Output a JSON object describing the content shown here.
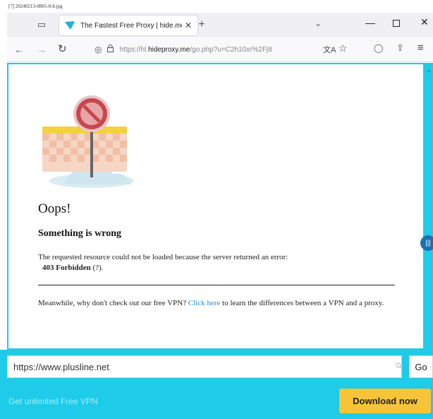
{
  "file_caption": "[7] 20240213-0805-0-8.jpg",
  "browser": {
    "tab": {
      "title": "The Fastest Free Proxy | hide.me",
      "close_glyph": "✕"
    },
    "new_tab_glyph": "+",
    "overflow_glyph": "⌄",
    "window_controls": {
      "minimize": "—",
      "close": "✕"
    },
    "nav": {
      "back": "←",
      "forward": "→",
      "reload": "↻"
    },
    "url": {
      "prefix": "https://hl.",
      "host": "hideproxy.me",
      "path": "/go.php?u=C2h10xr%2Fj8"
    },
    "icons": {
      "translate": "文A",
      "bookmark": "☆",
      "pocket": "◯",
      "extensions": "⇪",
      "menu": "≡",
      "shield": "◎",
      "lock": "🔒"
    }
  },
  "page": {
    "heading": "Oops!",
    "subheading": "Something is wrong",
    "error_message": "The requested resource could not be loaded because the server returned an error:",
    "error_code": "403 Forbidden",
    "error_help": "(?).",
    "vpn_text_before": "Meanwhile, why don't check out our free VPN?",
    "vpn_link": "Click here",
    "vpn_text_after": "to learn the differences between a VPN and a proxy.",
    "scroll_glyph": "^",
    "side_handle_glyph": "|||"
  },
  "proxy_bar": {
    "url_value": "https://www.plusline.net",
    "go_label": "Go",
    "promo_text": "Get unlimited Free VPN",
    "download_label": "Download now"
  },
  "colors": {
    "accent": "#1ecbe9",
    "download": "#f8c437",
    "link": "#1a8fd8"
  }
}
